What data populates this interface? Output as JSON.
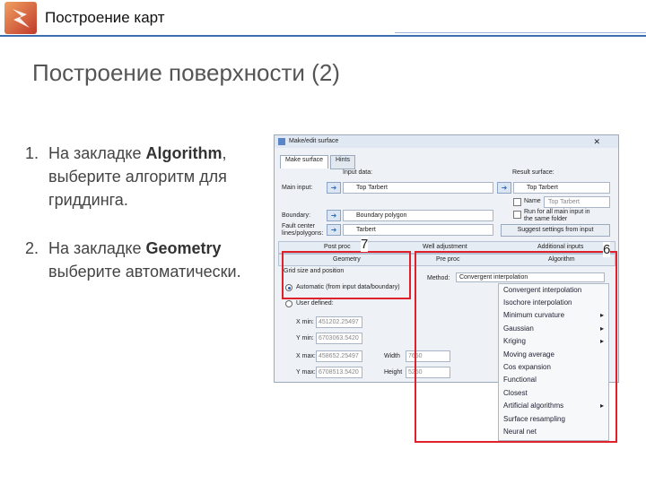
{
  "header": {
    "title": "Построение карт",
    "logo_icon": "lightning-logo-icon"
  },
  "slide": {
    "title": "Построение поверхности (2)"
  },
  "steps": [
    {
      "num": "1.",
      "pre": "На закладке ",
      "bold": "Algorithm",
      "post": ", выберите алгоритм для гриддинга."
    },
    {
      "num": "2.",
      "pre": "На закладке ",
      "bold": "Geometry",
      "post": " выберите автоматически."
    }
  ],
  "window": {
    "title": "Make/edit surface",
    "tabs": [
      "Make surface",
      "Hints"
    ],
    "input_data_label": "Input data:",
    "result_surface_label": "Result surface:",
    "main_input_label": "Main input:",
    "main_input_value": "Top Tarbert",
    "result_value": "Top Tarbert",
    "name_label": "Name",
    "name_value": "Top Tarbert",
    "run_all_label": "Run for all main input in the same folder",
    "boundary_label": "Boundary:",
    "boundary_value": "Boundary polygon",
    "fault_label": "Fault center lines/polygons:",
    "fault_value": "Tarbert",
    "suggest_button": "Suggest settings from input",
    "bar1": [
      "Post proc",
      "Well adjustment",
      "Additional inputs"
    ],
    "bar2": [
      "Geometry",
      "Pre proc",
      "Algorithm"
    ],
    "grid_size_label": "Grid size and position",
    "radio_auto": "Automatic (from input data/boundary)",
    "radio_user": "User defined:",
    "method_label": "Method:",
    "method_value": "Convergent interpolation",
    "xmin_label": "X min:",
    "xmin_value": "451202.25497",
    "ymin_label": "Y min:",
    "ymin_value": "6703063.5420",
    "xmax_label": "X max:",
    "xmax_value": "458652.25497",
    "ymax_label": "Y max:",
    "ymax_value": "6708513.5420",
    "width_label": "Width",
    "width_value": "7650",
    "height_label": "Height",
    "height_value": "5250"
  },
  "algorithms": [
    {
      "name": "Convergent interpolation",
      "sub": false
    },
    {
      "name": "Isochore interpolation",
      "sub": false
    },
    {
      "name": "Minimum curvature",
      "sub": true
    },
    {
      "name": "Gaussian",
      "sub": true
    },
    {
      "name": "Kriging",
      "sub": true
    },
    {
      "name": "Moving average",
      "sub": false
    },
    {
      "name": "Cos expansion",
      "sub": false
    },
    {
      "name": "Functional",
      "sub": false
    },
    {
      "name": "Closest",
      "sub": false
    },
    {
      "name": "Artificial algorithms",
      "sub": true
    },
    {
      "name": "Surface resampling",
      "sub": false
    },
    {
      "name": "Neural net",
      "sub": false
    }
  ],
  "callouts": {
    "geometry": "7",
    "algorithm": "6"
  },
  "colors": {
    "accent": "#3b6fb0",
    "highlight": "#e0202a"
  }
}
